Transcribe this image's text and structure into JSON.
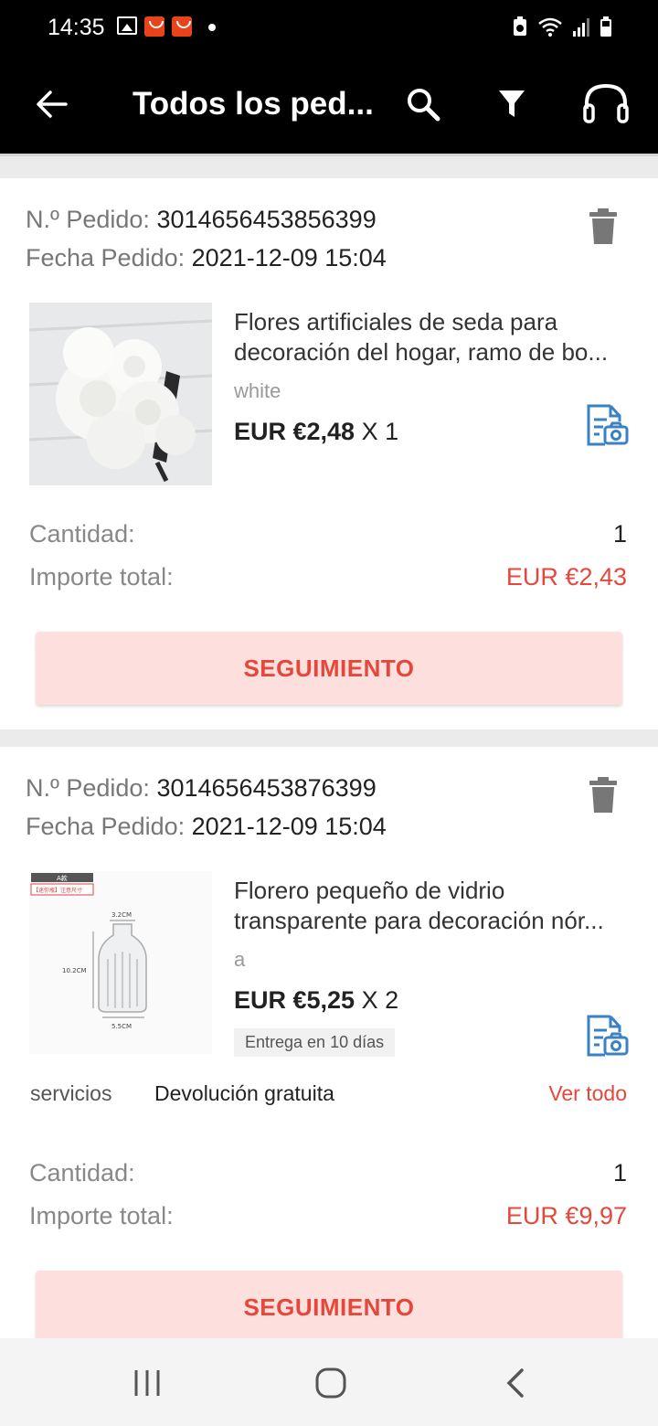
{
  "status_bar": {
    "time": "14:35"
  },
  "app_bar": {
    "title": "Todos los ped..."
  },
  "orders": [
    {
      "order_label": "N.º Pedido:",
      "order_number": "3014656453856399",
      "date_label": "Fecha Pedido:",
      "date": "2021-12-09 15:04",
      "product_title_line1": "Flores artificiales de seda para",
      "product_title_line2": "decoración del hogar, ramo de bo...",
      "variant": "white",
      "price": "EUR €2,48",
      "qty_suffix": "X 1",
      "quantity_label": "Cantidad:",
      "quantity": "1",
      "total_label": "Importe total:",
      "total": "EUR €2,43",
      "track_label": "SEGUIMIENTO"
    },
    {
      "order_label": "N.º Pedido:",
      "order_number": "3014656453876399",
      "date_label": "Fecha Pedido:",
      "date": "2021-12-09 15:04",
      "product_title_line1": "Florero pequeño de vidrio",
      "product_title_line2": "transparente para decoración nór...",
      "variant": "a",
      "price": "EUR €5,25",
      "qty_suffix": "X 2",
      "delivery": "Entrega en 10 días",
      "services_label": "servicios",
      "services_value": "Devolución gratuita",
      "services_link": "Ver todo",
      "quantity_label": "Cantidad:",
      "quantity": "1",
      "total_label": "Importe total:",
      "total": "EUR €9,97",
      "track_label": "SEGUIMIENTO",
      "thumb_labels": {
        "tag": "A款",
        "note": "【迷你瓶】注意尺寸",
        "top": "3.2CM",
        "height": "10.2CM",
        "base": "5.5CM"
      }
    }
  ],
  "colors": {
    "accent": "#e5483a",
    "button_bg": "#fde0dd",
    "topbar": "#000000"
  }
}
